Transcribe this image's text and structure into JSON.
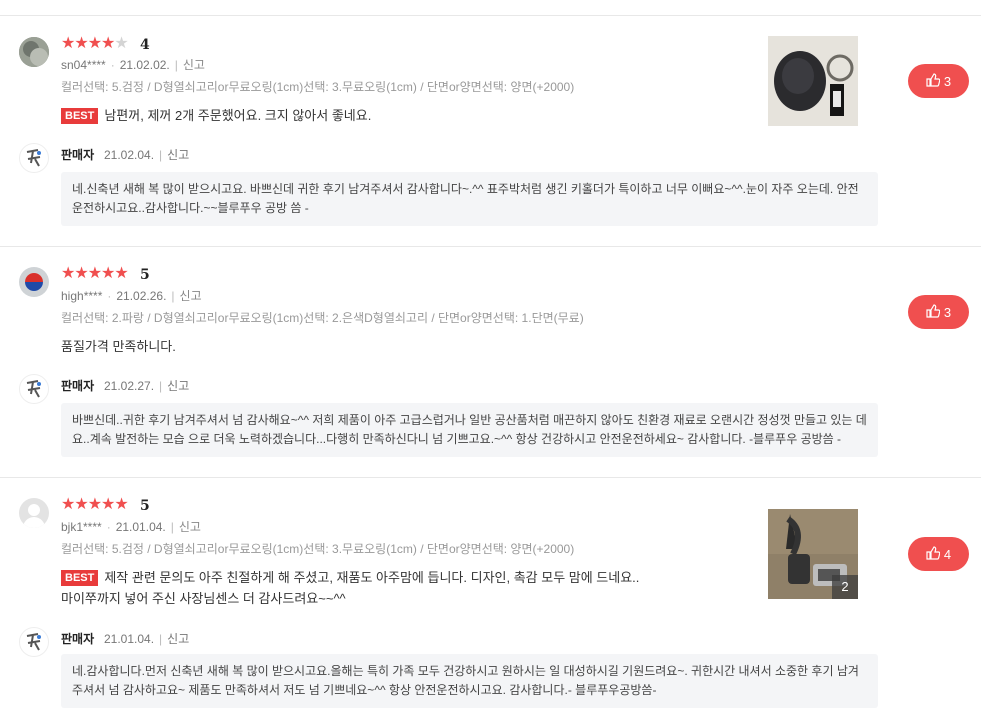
{
  "reviews": [
    {
      "rating": 4,
      "score_text": "4",
      "user": "sn04****",
      "date": "21.02.02.",
      "report": "신고",
      "options": "컬러선택: 5.검정 / D형열쇠고리or무료오링(1cm)선택: 3.무료오링(1cm) / 단면or양면선택: 양면(+2000)",
      "best": true,
      "best_label": "BEST",
      "body_line1": "남편꺼, 제꺼 2개 주문했어요. 크지 않아서 좋네요.",
      "body_line2": "",
      "likes": "3",
      "photo_count": "",
      "seller": {
        "name": "판매자",
        "date": "21.02.04.",
        "report": "신고",
        "reply": "네.신축년 새해 복 많이 받으시고요. 바쁘신데 귀한 후기 남겨주셔서 감사합니다~.^^ 표주박처럼 생긴 키홀더가 특이하고 너무 이뻐요~^^.눈이 자주 오는데. 안전운전하시고요..감사합니다.~~블루푸우 공방 씀 -"
      }
    },
    {
      "rating": 5,
      "score_text": "5",
      "user": "high****",
      "date": "21.02.26.",
      "report": "신고",
      "options": "컬러선택: 2.파랑 / D형열쇠고리or무료오링(1cm)선택: 2.은색D형열쇠고리 / 단면or양면선택: 1.단면(무료)",
      "best": false,
      "best_label": "",
      "body_line1": "품질가격 만족하니다.",
      "body_line2": "",
      "likes": "3",
      "photo_count": "",
      "seller": {
        "name": "판매자",
        "date": "21.02.27.",
        "report": "신고",
        "reply": "바쁘신데..귀한 후기 남겨주셔서 넘 감사해요~^^ 저희 제품이 아주 고급스럽거나 일반 공산품처럼 매끈하지 않아도 친환경 재료로 오랜시간 정성껏 만들고 있는 데요..계속 발전하는 모습 으로 더욱 노력하겠습니다...다행히 만족하신다니 넘 기쁘고요.~^^ 항상 건강하시고 안전운전하세요~ 감사합니다. -블루푸우 공방씀 -"
      }
    },
    {
      "rating": 5,
      "score_text": "5",
      "user": "bjk1****",
      "date": "21.01.04.",
      "report": "신고",
      "options": "컬러선택: 5.검정 / D형열쇠고리or무료오링(1cm)선택: 3.무료오링(1cm) / 단면or양면선택: 양면(+2000)",
      "best": true,
      "best_label": "BEST",
      "body_line1": "제작 관련 문의도 아주 친절하게 해 주셨고, 재품도 아주맘에 듭니다. 디자인, 촉감 모두 맘에 드네요..",
      "body_line2": "마이쭈까지 넣어 주신 사장님센스 더 감사드려요~~^^",
      "likes": "4",
      "photo_count": "2",
      "seller": {
        "name": "판매자",
        "date": "21.01.04.",
        "report": "신고",
        "reply": "네.감사합니다.먼저 신축년 새해 복 많이 받으시고요.올해는 특히 가족 모두 건강하시고 원하시는 일  대성하시길 기원드려요~. 귀한시간 내셔서  소중한 후기 남겨주셔서 넘 감사하고요~ 제품도 만족하셔서 저도 넘 기쁘네요~^^ 항상 안전운전하시고요. 감사합니다.- 블루푸우공방씀-"
      }
    }
  ]
}
